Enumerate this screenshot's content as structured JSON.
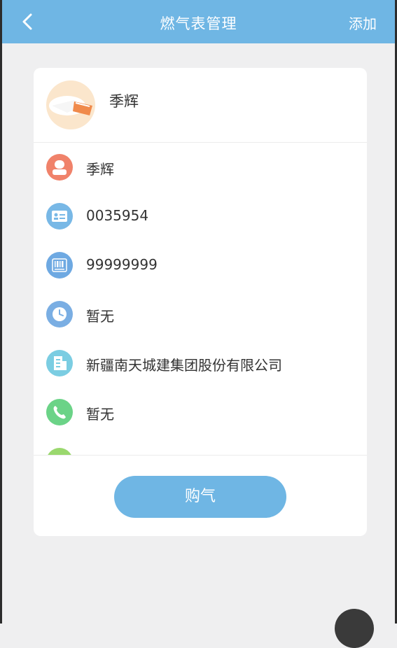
{
  "navbar": {
    "title": "燃气表管理",
    "add_label": "添加",
    "back_icon": "chevron-left-icon",
    "bg_color": "#6fb6e4"
  },
  "owner": {
    "name": "季辉"
  },
  "details": [
    {
      "icon": "person-icon",
      "color": "#f0826a",
      "text": "季辉"
    },
    {
      "icon": "id-card-icon",
      "color": "#78b8e6",
      "text": "0035954"
    },
    {
      "icon": "barcode-icon",
      "color": "#6ea9e2",
      "text": "99999999"
    },
    {
      "icon": "clock-icon",
      "color": "#7aaee3",
      "text": "暂无"
    },
    {
      "icon": "building-icon",
      "color": "#7bcde2",
      "text": "新疆南天城建集团股份有限公司"
    },
    {
      "icon": "phone-icon",
      "color": "#6bd387",
      "text": "暂无"
    },
    {
      "icon": "partial-icon",
      "color": "#9ad86e",
      "text": ""
    }
  ],
  "buy_button": {
    "label": "购气"
  }
}
